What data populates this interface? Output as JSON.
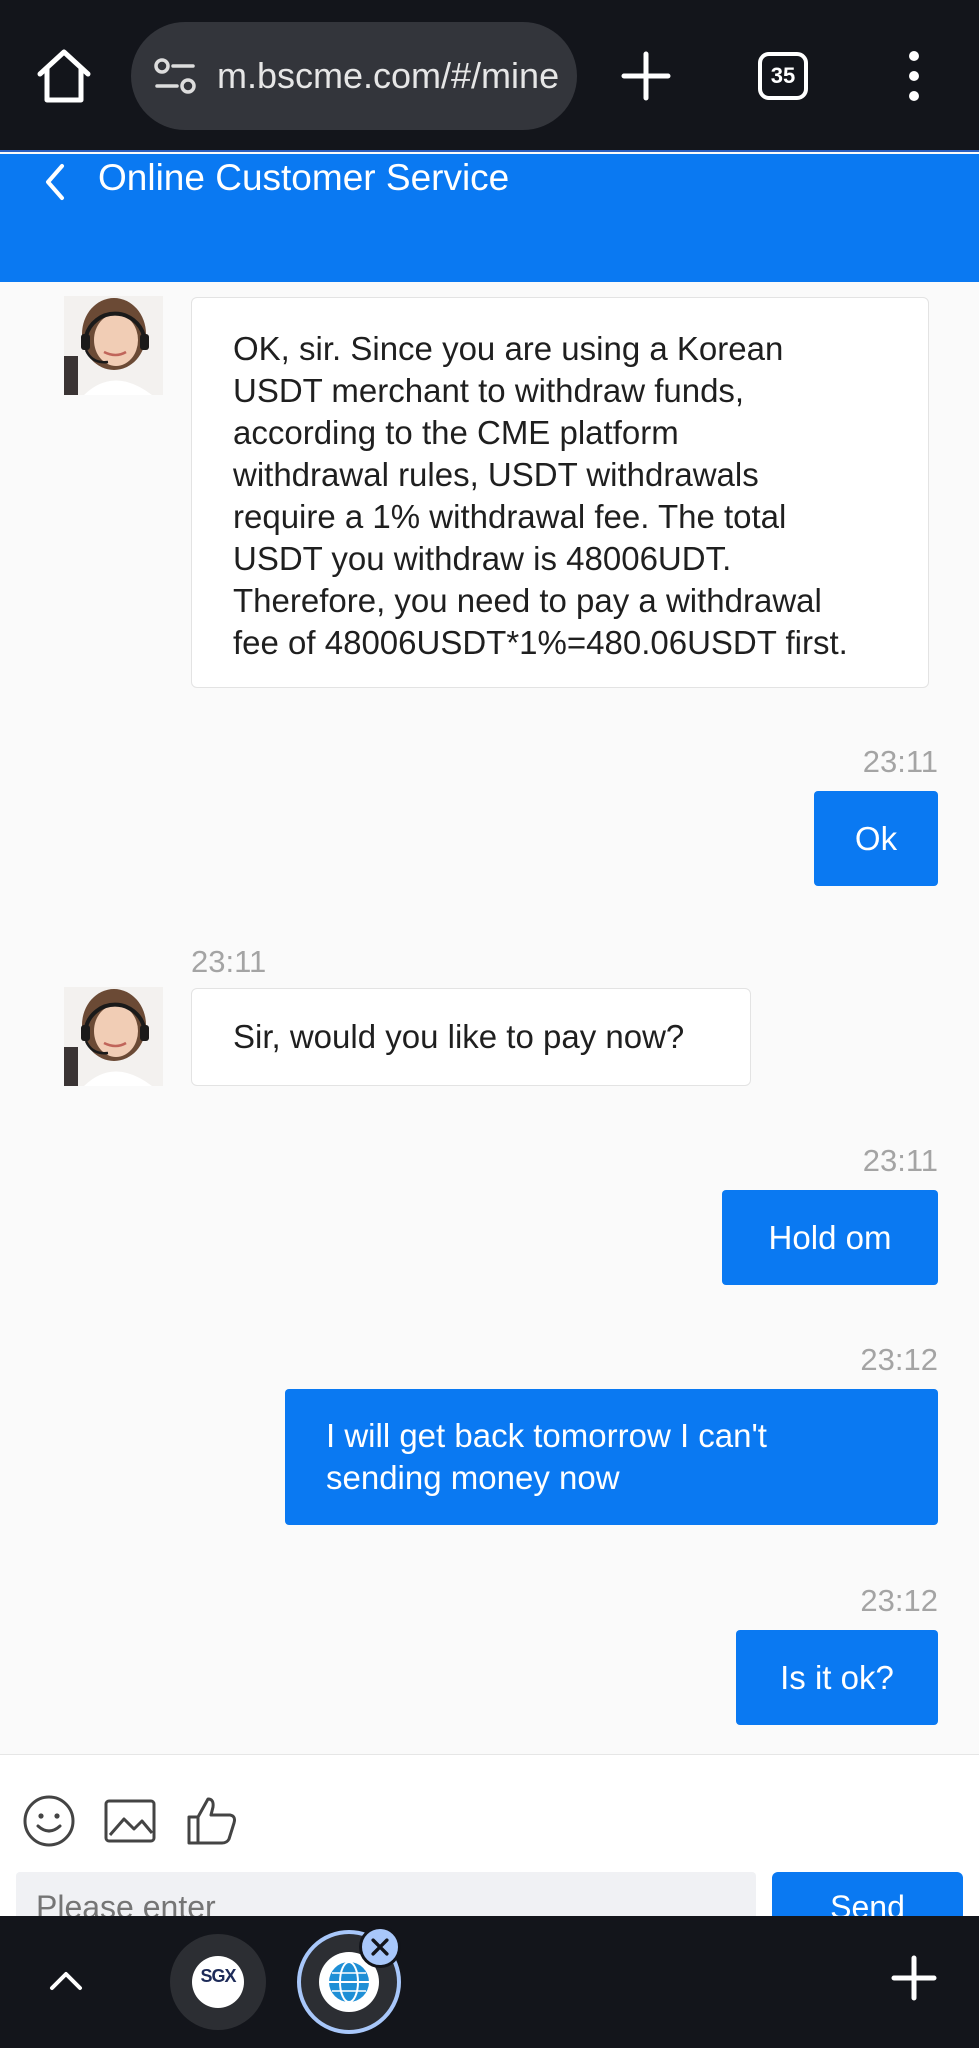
{
  "browser": {
    "url": "m.bscme.com/#/mine",
    "tab_count": "35"
  },
  "header": {
    "title": "Online Customer Service"
  },
  "messages": [
    {
      "side": "agent",
      "time": "",
      "lines": [
        "OK, sir. Since you are using a Korean",
        "USDT merchant to withdraw funds,",
        "according to the CME platform",
        "withdrawal rules, USDT withdrawals",
        "require a 1% withdrawal fee. The total",
        "USDT you withdraw is 48006UDT.",
        "Therefore, you need to pay a withdrawal",
        "fee of 48006USDT*1%=480.06USDT first."
      ]
    },
    {
      "side": "user",
      "time": "23:11",
      "text": "Ok"
    },
    {
      "side": "agent",
      "time": "23:11",
      "text": "Sir, would you like to pay now?"
    },
    {
      "side": "user",
      "time": "23:11",
      "text": "Hold om"
    },
    {
      "side": "user",
      "time": "23:12",
      "lines": [
        "I will get back tomorrow I can't",
        "sending money now"
      ]
    },
    {
      "side": "user",
      "time": "23:12",
      "text": "Is it ok?"
    }
  ],
  "composer": {
    "placeholder": "Please enter",
    "send_label": "Send"
  },
  "tab_strip": {
    "sgx_label": "SGX"
  },
  "colors": {
    "accent": "#0a79f2",
    "browser_chrome": "#13151b"
  }
}
